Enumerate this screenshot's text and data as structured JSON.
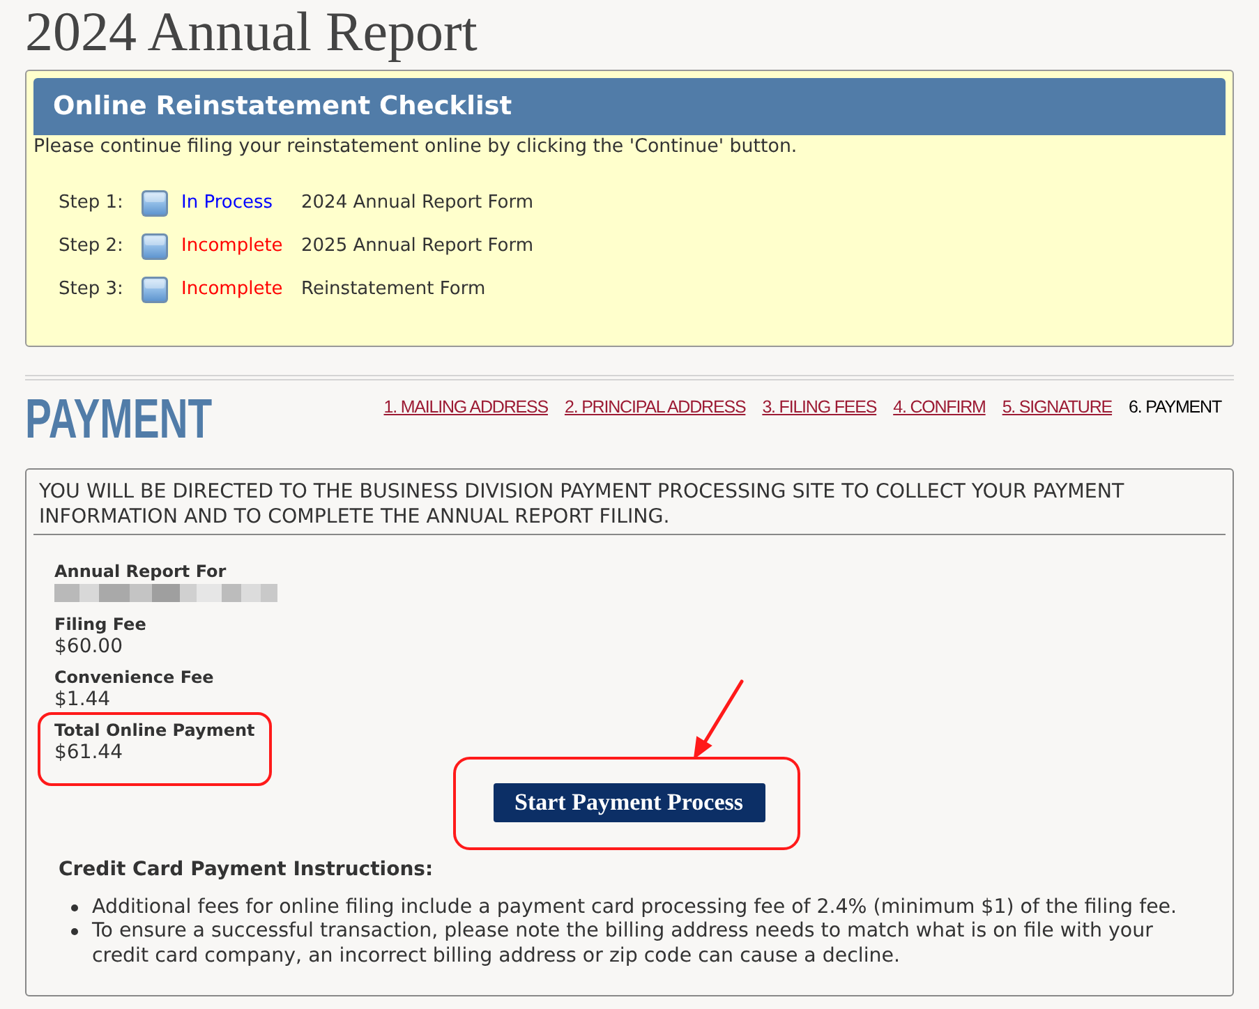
{
  "page_title": "2024 Annual Report",
  "checklist": {
    "title": "Online Reinstatement Checklist",
    "intro": "Please continue filing your reinstatement online by clicking the 'Continue' button.",
    "steps": [
      {
        "label": "Step 1:",
        "status": "In Process",
        "kind": "in_process",
        "form": "2024 Annual Report Form"
      },
      {
        "label": "Step 2:",
        "status": "Incomplete",
        "kind": "incomplete",
        "form": "2025 Annual Report Form"
      },
      {
        "label": "Step 3:",
        "status": "Incomplete",
        "kind": "incomplete",
        "form": "Reinstatement Form"
      }
    ]
  },
  "payment": {
    "heading": "PAYMENT",
    "wizard_steps": [
      {
        "label": "1. MAILING ADDRESS",
        "selected": false
      },
      {
        "label": "2. PRINCIPAL ADDRESS",
        "selected": false
      },
      {
        "label": "3. FILING FEES",
        "selected": false
      },
      {
        "label": "4. CONFIRM",
        "selected": false
      },
      {
        "label": "5. SIGNATURE",
        "selected": false
      },
      {
        "label": "6. PAYMENT",
        "selected": true
      }
    ],
    "notice": "YOU WILL BE DIRECTED TO THE BUSINESS DIVISION PAYMENT PROCESSING SITE TO COLLECT YOUR PAYMENT INFORMATION AND TO COMPLETE THE ANNUAL REPORT FILING.",
    "details": [
      {
        "label": "Annual Report For",
        "kind": "redacted",
        "highlighted": false
      },
      {
        "label": "Filing Fee",
        "kind": "amount",
        "value": "$60.00",
        "highlighted": false
      },
      {
        "label": "Convenience Fee",
        "kind": "amount",
        "value": "$1.44",
        "highlighted": false
      },
      {
        "label": "Total Online Payment",
        "kind": "amount",
        "value": "$61.44",
        "highlighted": true
      }
    ],
    "start_button": {
      "label": "Start Payment Process",
      "highlighted": true,
      "arrow": true
    },
    "instructions": {
      "title": "Credit Card Payment Instructions:",
      "items": [
        "Additional fees for online filing include a payment card processing fee of 2.4% (minimum $1) of the filing fee.",
        "To ensure a successful transaction, please note the billing address needs to match what is on file with your credit card company, an incorrect billing address or zip code can cause a decline."
      ]
    }
  }
}
